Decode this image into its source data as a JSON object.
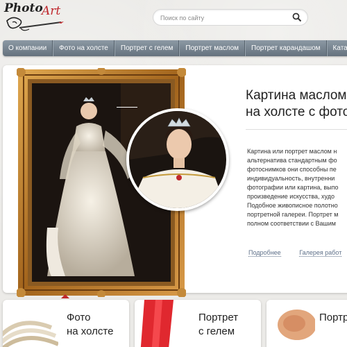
{
  "logo": {
    "photo": "Photo",
    "art": "Art"
  },
  "search": {
    "placeholder": "Поиск по сайту"
  },
  "nav": {
    "items": [
      {
        "label": "О компании"
      },
      {
        "label": "Фото на холсте"
      },
      {
        "label": "Портрет с гелем"
      },
      {
        "label": "Портрет маслом"
      },
      {
        "label": "Портрет карандашом"
      },
      {
        "label": "Катало"
      }
    ]
  },
  "feature": {
    "title_line1": "Картина маслом",
    "title_line2": "на холсте с фото",
    "description": [
      "Картина или портрет маслом н",
      "альтернатива стандартным фо",
      "фотоснимков они способны пе",
      "индивидуальность, внутренни",
      "фотографии или картина, выпо",
      "произведение искусства, худо",
      "Подобное живописное полотно",
      "портретной галереи. Портрет м",
      "полном соответствии с Вашим"
    ],
    "link_more": "Подробнее",
    "link_gallery": "Галерея работ"
  },
  "cards": [
    {
      "line1": "Фото",
      "line2": "на холсте"
    },
    {
      "line1": "Портрет",
      "line2": "с гелем"
    },
    {
      "line1": "Портрет",
      "line2": ""
    }
  ],
  "colors": {
    "accent": "#c0282d",
    "nav": "#76838e",
    "link": "#5d6f88",
    "frame_gold": "#b07a2a"
  }
}
